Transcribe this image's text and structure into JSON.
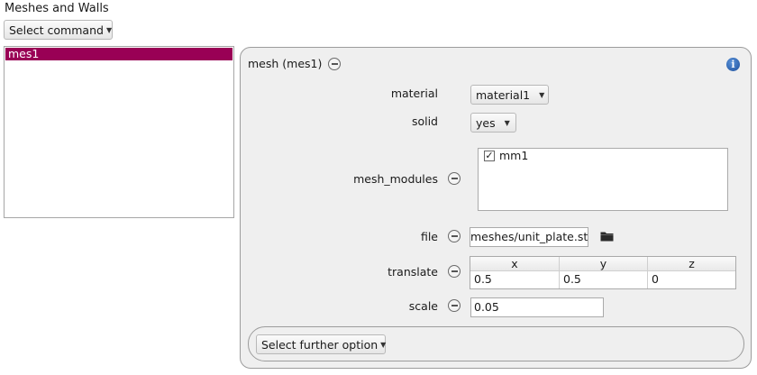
{
  "section": {
    "title": "Meshes and Walls"
  },
  "command_dropdown": {
    "label": "Select command"
  },
  "list": {
    "items": [
      "mes1"
    ],
    "selected": "mes1"
  },
  "panel": {
    "title": "mesh (mes1)",
    "fields": {
      "material": {
        "label": "material",
        "value": "material1"
      },
      "solid": {
        "label": "solid",
        "value": "yes"
      },
      "mesh_modules": {
        "label": "mesh_modules",
        "items": [
          {
            "name": "mm1",
            "checked": true
          }
        ]
      },
      "file": {
        "label": "file",
        "value": "meshes/unit_plate.stl"
      },
      "translate": {
        "label": "translate",
        "columns": [
          "x",
          "y",
          "z"
        ],
        "values": [
          "0.5",
          "0.5",
          "0"
        ]
      },
      "scale": {
        "label": "scale",
        "value": "0.05"
      }
    },
    "further_option_label": "Select further option"
  },
  "icons": {
    "info": "info-icon",
    "remove": "minus-circle-icon",
    "folder": "folder-icon",
    "dropdown": "caret-down-icon"
  },
  "colors": {
    "selection": "#990055",
    "panel_bg": "#efefef"
  }
}
